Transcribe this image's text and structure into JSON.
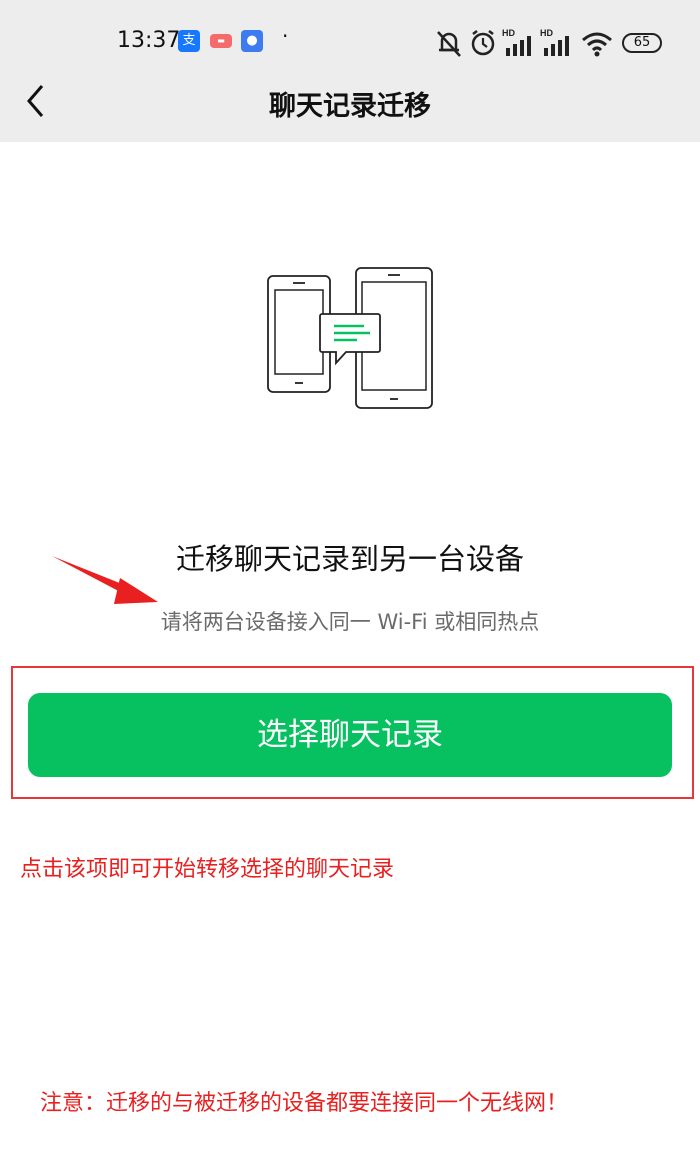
{
  "status_bar": {
    "time": "13:37",
    "hd_label": "HD",
    "battery": "65",
    "icons": [
      "alipay-icon",
      "weibo-icon",
      "baidu-icon",
      "mute-bell-icon",
      "alarm-icon",
      "signal-icon",
      "wifi-icon",
      "battery-icon"
    ]
  },
  "nav": {
    "title": "聊天记录迁移",
    "back_icon": "chevron-left-icon"
  },
  "content": {
    "illustration_icon": "phones-transfer-icon",
    "heading": "迁移聊天记录到另一台设备",
    "subheading": "请将两台设备接入同一 Wi-Fi 或相同热点",
    "button_label": "选择聊天记录"
  },
  "annotations": {
    "button_note": "点击该项即可开始转移选择的聊天记录",
    "bottom_note": "注意：迁移的与被迁移的设备都要连接同一个无线网！"
  },
  "colors": {
    "accent": "#07c160",
    "annotation": "#e8201f",
    "topbar": "#ededed"
  }
}
